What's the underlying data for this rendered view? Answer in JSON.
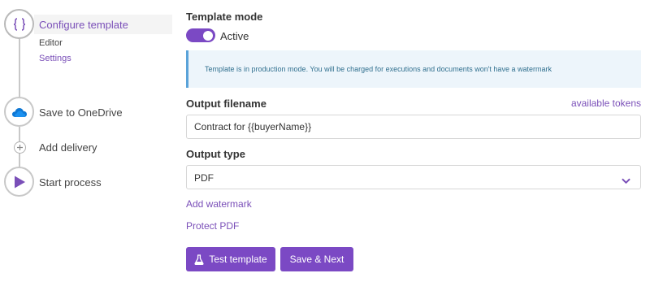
{
  "steps": [
    {
      "label": "Configure template",
      "icon": "braces-icon",
      "active": true,
      "sub_items": [
        {
          "label": "Editor"
        },
        {
          "label": "Settings"
        }
      ]
    },
    {
      "label": "Save to OneDrive",
      "icon": "onedrive-cloud-icon"
    },
    {
      "label": "Add delivery",
      "icon": "plus-icon"
    },
    {
      "label": "Start process",
      "icon": "play-icon"
    }
  ],
  "template_mode": {
    "label": "Template mode",
    "toggle_on": true,
    "toggle_label": "Active"
  },
  "info": {
    "text": "Template is in production mode. You will be charged for executions and documents won't have a watermark"
  },
  "output_filename": {
    "label": "Output filename",
    "tokens_link": "available tokens",
    "value": "Contract for {{buyerName}}"
  },
  "output_type": {
    "label": "Output type",
    "selected": "PDF"
  },
  "links": {
    "add_watermark": "Add watermark",
    "protect_pdf": "Protect PDF"
  },
  "buttons": {
    "test_template": "Test template",
    "save_next": "Save & Next"
  },
  "colors": {
    "accent": "#7b49c4",
    "link": "#7a4fb8",
    "info_bg": "#edf5fb",
    "info_border": "#5aa3d9",
    "onedrive": "#0f78d4"
  }
}
